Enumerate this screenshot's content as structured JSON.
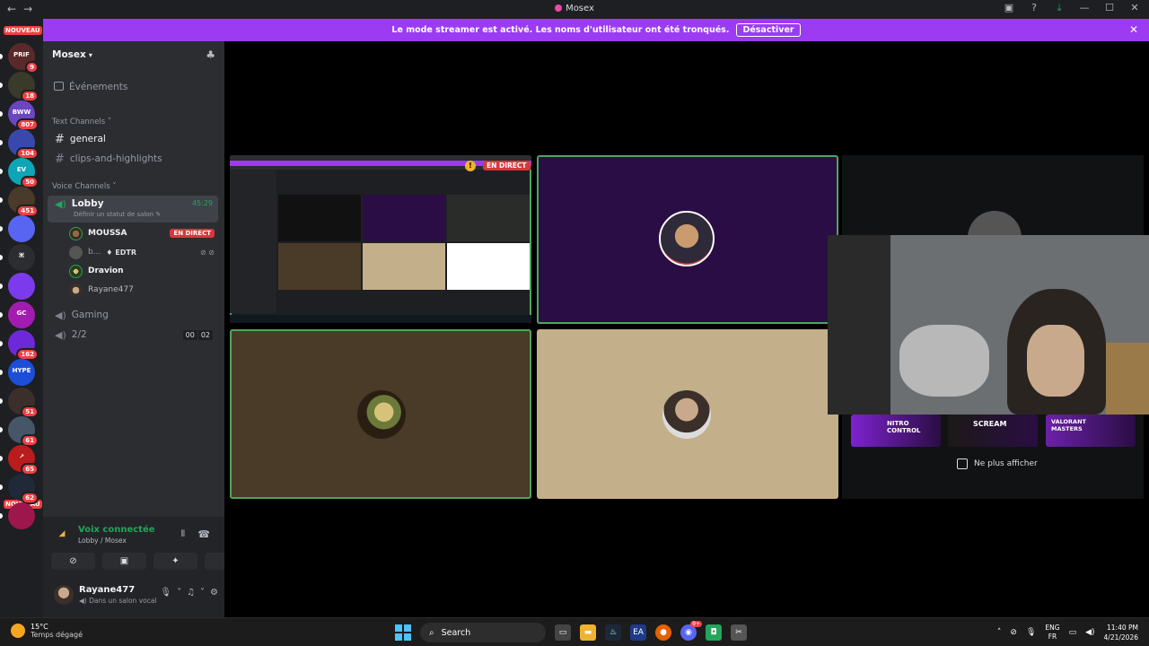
{
  "window": {
    "title": "Mosex",
    "nav_back": "←",
    "nav_fwd": "→",
    "controls": [
      "▣",
      "?",
      "⤓",
      "—",
      "☐",
      "✕"
    ]
  },
  "banner": {
    "text": "Le mode streamer est activé. Les noms d'utilisateur ont été tronqués.",
    "button": "Désactiver",
    "close": "✕"
  },
  "rail": {
    "nouveau_top": "NOUVEAU",
    "nouveau_bottom": "NOUVEAU",
    "servers": [
      {
        "badge": "9",
        "color": "#5a2a2a",
        "label": "PRIF"
      },
      {
        "badge": "18",
        "color": "#3a3a2a",
        "label": ""
      },
      {
        "badge": "807",
        "color": "#6b46c1",
        "label": "BWW"
      },
      {
        "badge": "104",
        "color": "#3949ab",
        "label": ""
      },
      {
        "badge": "50",
        "color": "#0ea5b7",
        "label": "EV"
      },
      {
        "badge": "451",
        "color": "#4a3a2a",
        "label": ""
      },
      {
        "badge": "",
        "color": "#5865f2",
        "label": ""
      },
      {
        "badge": "",
        "color": "#2b2d31",
        "label": "⌘"
      },
      {
        "badge": "",
        "color": "#7c3aed",
        "label": ""
      },
      {
        "badge": "",
        "color": "#a21caf",
        "label": "GC"
      },
      {
        "badge": "162",
        "color": "#6d28d9",
        "label": ""
      },
      {
        "badge": "",
        "color": "#1d4ed8",
        "label": "HYPE"
      },
      {
        "badge": "51",
        "color": "#3a2f2a",
        "label": ""
      },
      {
        "badge": "61",
        "color": "#475569",
        "label": ""
      },
      {
        "badge": "65",
        "color": "#b91c1c",
        "label": "↗"
      },
      {
        "badge": "62",
        "color": "#1f2937",
        "label": ""
      },
      {
        "badge": "",
        "color": "#9d174d",
        "label": ""
      }
    ]
  },
  "sidebar": {
    "server_name": "Mosex",
    "events": "Événements",
    "text_category": "Text Channels",
    "text_channels": [
      "general",
      "clips-and-highlights"
    ],
    "voice_category": "Voice Channels",
    "lobby": {
      "name": "Lobby",
      "status_prompt": "Définir un statut de salon",
      "elapsed": "45:29"
    },
    "members": [
      {
        "name": "MOUSSA",
        "tag": "EN DIRECT",
        "extra": ""
      },
      {
        "name": "b...",
        "tag": "",
        "extra": "EDTR"
      },
      {
        "name": "Dravion",
        "tag": "",
        "extra": ""
      },
      {
        "name": "Rayane477",
        "tag": "",
        "extra": ""
      }
    ],
    "voice_channels": [
      {
        "name": "Gaming",
        "counts": []
      },
      {
        "name": "2/2",
        "counts": [
          "00",
          "02"
        ]
      }
    ]
  },
  "voice_panel": {
    "title": "Voix connectée",
    "subtitle": "Lobby / Mosex",
    "user": "Rayane477",
    "user_status": "Dans un salon vocal"
  },
  "stage": {
    "live_label": "EN DIRECT",
    "warn": "!"
  },
  "promo": {
    "checkbox_label": "Ne plus afficher",
    "images": [
      {
        "text": "NITRO CONTROL",
        "color": "#7e22ce"
      },
      {
        "text": "SCREAM",
        "color": "#1c1917"
      },
      {
        "text": "VALORANT MASTERS",
        "color": "#6b21a8"
      }
    ]
  },
  "taskbar": {
    "temp": "15°C",
    "weather": "Temps dégagé",
    "search": "Search",
    "lang1": "ENG",
    "lang2": "FR",
    "time": "11:40 PM",
    "date": "4/21/2026",
    "discord_badge": "9+"
  }
}
